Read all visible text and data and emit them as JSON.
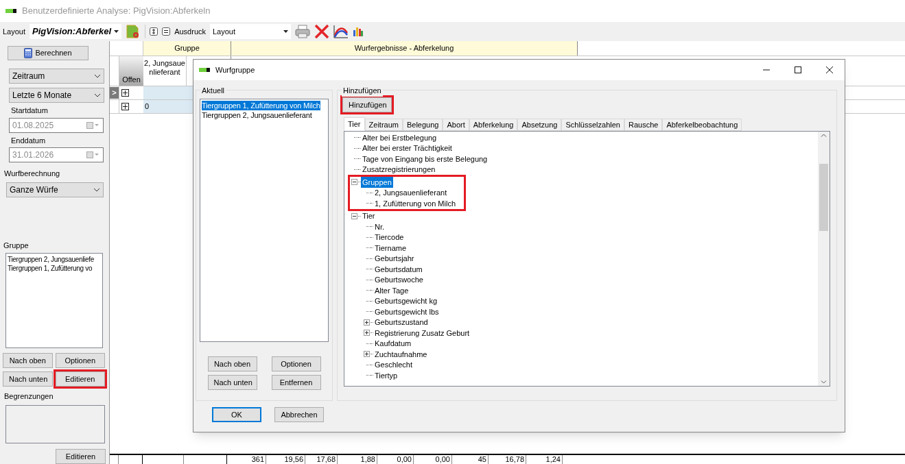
{
  "window": {
    "title": "Benutzerdefinierte Analyse: PigVision:Abferkeln"
  },
  "toolbar": {
    "layout_label": "Layout",
    "layout_value": "PigVision:Abferkel",
    "print_label": "Ausdruck",
    "print_value": "Layout"
  },
  "left_panel": {
    "calculate_button": "Berechnen",
    "period_select": "Zeitraum",
    "range_select": "Letzte 6 Monate",
    "start_label": "Startdatum",
    "start_value": "01.08.2025",
    "end_label": "Enddatum",
    "end_value": "31.01.2026",
    "litter_label": "Wurfberechnung",
    "litter_select": "Ganze Würfe",
    "group_label": "Gruppe",
    "group_items": [
      "Tiergruppen 2, Jungsauenliefe",
      "Tiergruppen 1, Zufütterung vo"
    ],
    "buttons": [
      {
        "label": "Nach oben",
        "highlighted": false
      },
      {
        "label": "Optionen",
        "highlighted": false
      },
      {
        "label": "Nach unten",
        "highlighted": false
      },
      {
        "label": "Editieren",
        "highlighted": true
      }
    ],
    "limits_label": "Begrenzungen",
    "limits_button": "Editieren"
  },
  "grid": {
    "groups": [
      {
        "label": "Gruppe",
        "kind": "group"
      },
      {
        "label": "Wurfergebnisse - Abferkelung",
        "kind": "results"
      }
    ],
    "row_header": "Offen",
    "column_header": "2, Jungsauenlieferant",
    "rows": [
      {
        "current": true,
        "value": ""
      },
      {
        "current": false,
        "value": "0"
      }
    ],
    "current_marker": ">",
    "totals": [
      "361",
      "19,56",
      "17,68",
      "1,88",
      "0,00",
      "0,00",
      "45",
      "16,78",
      "1,24"
    ]
  },
  "dialog": {
    "title": "Wurfgruppe",
    "current_group": {
      "label": "Aktuell",
      "items": [
        {
          "label": "Tiergruppen 1, Zufütterung von Milch",
          "selected": true
        },
        {
          "label": "Tiergruppen 2, Jungsauenlieferant",
          "selected": false
        }
      ],
      "buttons": [
        "Nach oben",
        "Optionen",
        "Nach unten",
        "Entfernen"
      ]
    },
    "add_group": {
      "label": "Hinzufügen",
      "button": {
        "label": "Hinzufügen",
        "highlighted": true
      },
      "tabs": [
        {
          "label": "Tier",
          "selected": true
        },
        {
          "label": "Zeitraum",
          "selected": false
        },
        {
          "label": "Belegung",
          "selected": false
        },
        {
          "label": "Abort",
          "selected": false
        },
        {
          "label": "Abferkelung",
          "selected": false
        },
        {
          "label": "Absetzung",
          "selected": false
        },
        {
          "label": "Schlüsselzahlen",
          "selected": false
        },
        {
          "label": "Rausche",
          "selected": false
        },
        {
          "label": "Abferkelbeobachtung",
          "selected": false
        }
      ],
      "tree": [
        {
          "label": "Alter bei Erstbelegung",
          "selected": false,
          "highlighted": false
        },
        {
          "label": "Alter bei erster Trächtigkeit",
          "selected": false,
          "highlighted": false
        },
        {
          "label": "Tage von Eingang bis erste Belegung",
          "selected": false,
          "highlighted": false
        },
        {
          "label": "Zusatzregistrierungen",
          "selected": false,
          "highlighted": false
        },
        {
          "label": "Gruppen",
          "selected": true,
          "highlighted": true,
          "expanded": true,
          "children": [
            {
              "label": "2, Jungsauenlieferant",
              "selected": false
            },
            {
              "label": "1, Zufütterung von Milch",
              "selected": false
            }
          ]
        },
        {
          "label": "Tier",
          "selected": false,
          "highlighted": false,
          "expanded": true,
          "children": [
            {
              "label": "Nr.",
              "selected": false
            },
            {
              "label": "Tiercode",
              "selected": false
            },
            {
              "label": "Tiername",
              "selected": false
            },
            {
              "label": "Geburtsjahr",
              "selected": false
            },
            {
              "label": "Geburtsdatum",
              "selected": false
            },
            {
              "label": "Geburtswoche",
              "selected": false
            },
            {
              "label": "Alter Tage",
              "selected": false
            },
            {
              "label": "Geburtsgewicht kg",
              "selected": false
            },
            {
              "label": "Geburtsgewicht lbs",
              "selected": false
            },
            {
              "label": "Geburtszustand",
              "selected": false,
              "expanded": false
            },
            {
              "label": "Registrierung Zusatz Geburt",
              "selected": false,
              "expanded": false
            },
            {
              "label": "Kaufdatum",
              "selected": false
            },
            {
              "label": "Zuchtaufnahme",
              "selected": false,
              "expanded": false
            },
            {
              "label": "Geschlecht",
              "selected": false
            },
            {
              "label": "Tiertyp",
              "selected": false
            }
          ]
        }
      ]
    },
    "ok_button": "OK",
    "cancel_button": "Abbrechen"
  }
}
